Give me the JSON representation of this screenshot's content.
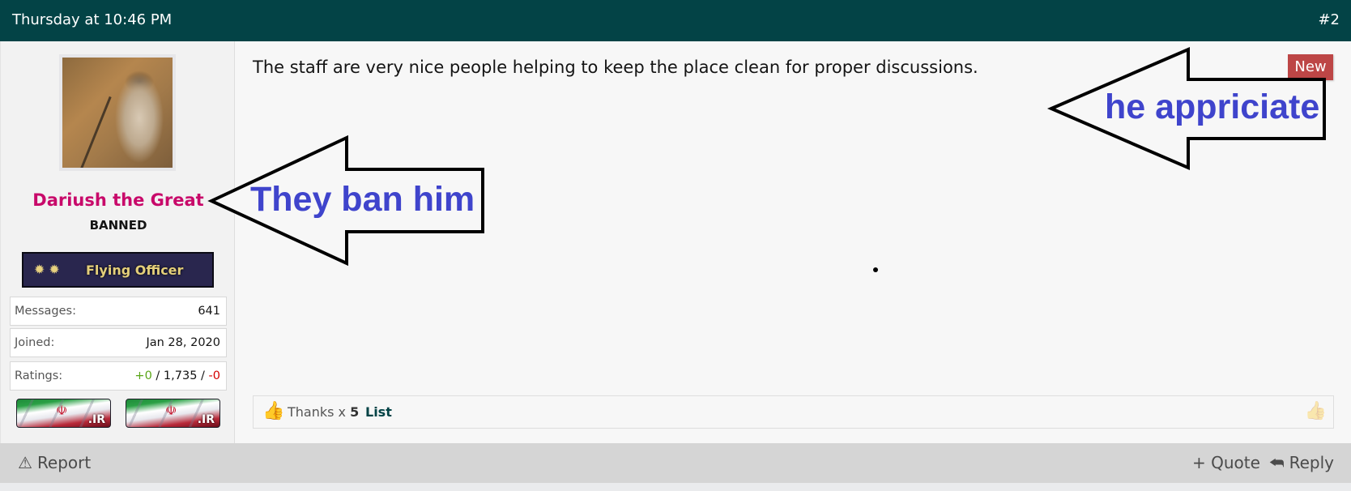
{
  "header": {
    "timestamp": "Thursday at 10:46 PM",
    "post_number": "#2"
  },
  "user": {
    "name": "Dariush the Great",
    "title": "BANNED",
    "avatar_icon": "avatar-image",
    "rank_banner": {
      "stars_icon": "two-stars-icon",
      "label": "Flying Officer"
    },
    "stats": [
      {
        "label": "Messages:",
        "value": "641"
      },
      {
        "label": "Joined:",
        "value": "Jan 28, 2020"
      }
    ],
    "ratings": {
      "label": "Ratings:",
      "positive": "+0",
      "sep1": " / ",
      "neutral": "1,735",
      "sep2": " / ",
      "negative": "-0"
    },
    "flags": [
      {
        "emblem": "☫",
        "tld": ".IR"
      },
      {
        "emblem": "☫",
        "tld": ".IR"
      }
    ]
  },
  "post": {
    "body": "The staff are very nice people helping to keep the place clean for proper discussions.",
    "badge": "New",
    "reactions": {
      "icon": "thumbs-up-icon",
      "label": "Thanks x ",
      "count": "5",
      "list_link": "List"
    }
  },
  "actions": {
    "report": "Report",
    "quote": "+ Quote",
    "reply": "Reply"
  },
  "annotations": {
    "left_arrow_text": "They ban him",
    "right_arrow_text": "he appriciate"
  },
  "colors": {
    "header_bg": "#034346",
    "username": "#c8096a",
    "new_badge": "#bd4646",
    "annotation_text": "#3f44cc",
    "rating_positive": "#5aa618",
    "rating_negative": "#d40000"
  }
}
